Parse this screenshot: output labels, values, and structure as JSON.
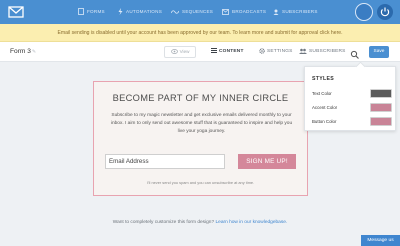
{
  "nav": {
    "items": [
      {
        "label": "FORMS",
        "icon": "document-icon"
      },
      {
        "label": "AUTOMATIONS",
        "icon": "lightning-icon"
      },
      {
        "label": "SEQUENCES",
        "icon": "sequence-icon"
      },
      {
        "label": "BROADCASTS",
        "icon": "broadcast-icon"
      },
      {
        "label": "SUBSCRIBERS",
        "icon": "subscribers-icon"
      }
    ],
    "colors": {
      "bar": "#4a8fd1"
    }
  },
  "alert": {
    "text": "Email sending is disabled until your account has been approved by our team. To learn more and submit for approval click here."
  },
  "toolbar": {
    "form_title": "Form 3",
    "view_label": "View",
    "tabs": [
      {
        "label": "CONTENT",
        "active": true
      },
      {
        "label": "SETTINGS",
        "active": false
      },
      {
        "label": "SUBSCRIBERS",
        "active": false
      }
    ],
    "save_label": "Save"
  },
  "form": {
    "title": "BECOME PART OF MY INNER CIRCLE",
    "description": "Subscribe to my magic newsletter and get exclusive emails delivered monthly to your inbox. I aim to only send out awesome stuff that is guaranteed to inspire and help you live your yoga journey.",
    "email_placeholder": "Email Address",
    "button_label": "SIGN ME UP!",
    "fine_print": "I'll never send you spam and you can unsubscribe at any time."
  },
  "footer": {
    "text": "Want to completely customize this form design?",
    "link": "Learn how in our knowledgebase."
  },
  "styles_panel": {
    "title": "STYLES",
    "rows": [
      {
        "label": "Text Color",
        "color": "#5b5b5b"
      },
      {
        "label": "Accent Color",
        "color": "#c98497"
      },
      {
        "label": "Button Color",
        "color": "#c98497"
      }
    ]
  },
  "message_us": "Message us"
}
